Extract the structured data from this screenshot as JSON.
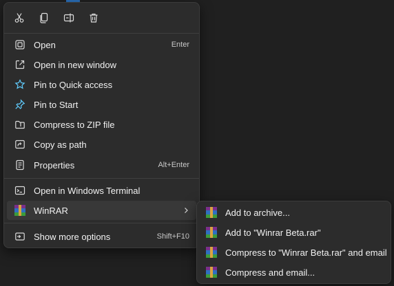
{
  "quick_actions": [
    {
      "name": "cut-icon"
    },
    {
      "name": "copy-icon"
    },
    {
      "name": "rename-icon"
    },
    {
      "name": "delete-icon"
    }
  ],
  "menu": {
    "items": [
      {
        "label": "Open",
        "shortcut": "Enter",
        "icon": "open-icon"
      },
      {
        "label": "Open in new window",
        "icon": "open-new-window-icon"
      },
      {
        "label": "Pin to Quick access",
        "icon": "star-icon"
      },
      {
        "label": "Pin to Start",
        "icon": "pin-icon"
      },
      {
        "label": "Compress to ZIP file",
        "icon": "zip-icon"
      },
      {
        "label": "Copy as path",
        "icon": "copy-path-icon"
      },
      {
        "label": "Properties",
        "shortcut": "Alt+Enter",
        "icon": "properties-icon"
      },
      {
        "label": "Open in Windows Terminal",
        "icon": "terminal-icon"
      },
      {
        "label": "WinRAR",
        "icon": "winrar-icon"
      },
      {
        "label": "Show more options",
        "shortcut": "Shift+F10",
        "icon": "more-options-icon"
      }
    ]
  },
  "submenu": {
    "items": [
      {
        "label": "Add to archive..."
      },
      {
        "label": "Add to \"Winrar Beta.rar\""
      },
      {
        "label": "Compress to \"Winrar Beta.rar\" and email"
      },
      {
        "label": "Compress and email..."
      }
    ]
  },
  "colors": {
    "menu_bg": "#2c2c2c",
    "highlight": "#383838",
    "accent": "#60cdff",
    "text": "#f2f2f2"
  }
}
